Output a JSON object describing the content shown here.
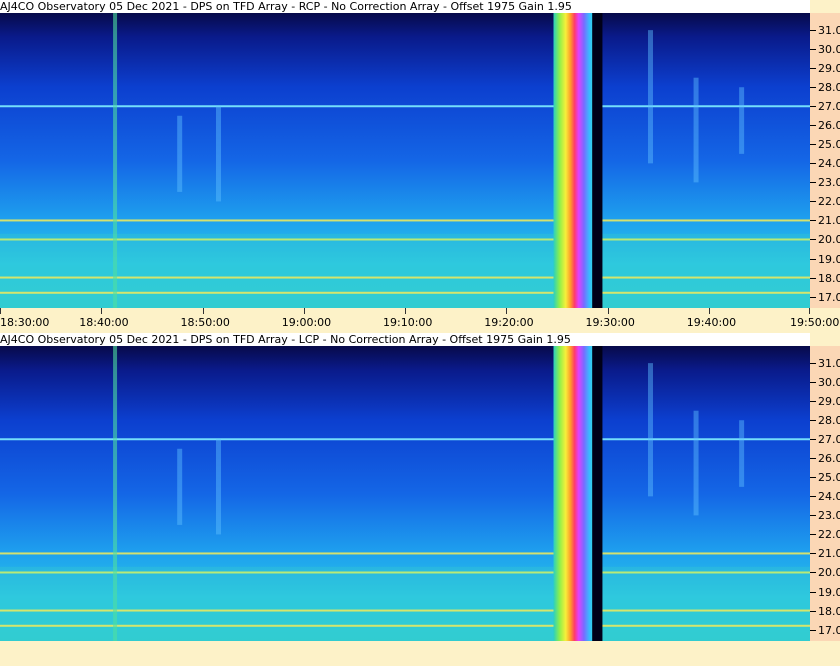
{
  "colors": {
    "title_bg": "#ffffff",
    "axis_bg": "#fbd7b5",
    "footer_bg": "#fdf2c8"
  },
  "chart_data": [
    {
      "type": "heatmap",
      "title": "AJ4CO Observatory 05 Dec 2021 - DPS on TFD Array  - RCP  -  No Correction Array  -  Offset 1975  Gain 1.95",
      "x_tick_labels": [
        "18:30:00",
        "18:40:00",
        "18:50:00",
        "19:00:00",
        "19:10:00",
        "19:20:00",
        "19:30:00",
        "19:40:00",
        "19:50:00"
      ],
      "y_tick_labels": [
        "31.0",
        "30.0",
        "29.0",
        "28.0",
        "27.0",
        "26.0",
        "25.0",
        "24.0",
        "23.0",
        "22.0",
        "21.0",
        "20.0",
        "19.0",
        "18.0",
        "17.0"
      ],
      "ylim": [
        16.4,
        31.9
      ],
      "xlim": [
        "18:30:00",
        "19:50:00"
      ],
      "persistent_lines_mhz": [
        27.0,
        21.0,
        20.0,
        18.0,
        17.2
      ],
      "broadband_event": [
        "19:24:40",
        "19:28:40"
      ],
      "data_gap": [
        "19:27:30",
        "19:29:30"
      ]
    },
    {
      "type": "heatmap",
      "title": "AJ4CO Observatory 05 Dec 2021 - DPS on TFD Array  - LCP  -  No Correction Array  -  Offset 1975  Gain 1.95",
      "x_tick_labels": [],
      "y_tick_labels": [
        "31.0",
        "30.0",
        "29.0",
        "28.0",
        "27.0",
        "26.0",
        "25.0",
        "24.0",
        "23.0",
        "22.0",
        "21.0",
        "20.0",
        "19.0",
        "18.0",
        "17.0"
      ],
      "ylim": [
        16.4,
        31.9
      ],
      "xlim": [
        "18:30:00",
        "19:50:00"
      ],
      "persistent_lines_mhz": [
        27.0,
        21.0,
        20.0,
        18.0,
        17.2
      ],
      "broadband_event": [
        "19:24:40",
        "19:28:40"
      ],
      "data_gap": [
        "19:27:30",
        "19:29:30"
      ]
    }
  ]
}
